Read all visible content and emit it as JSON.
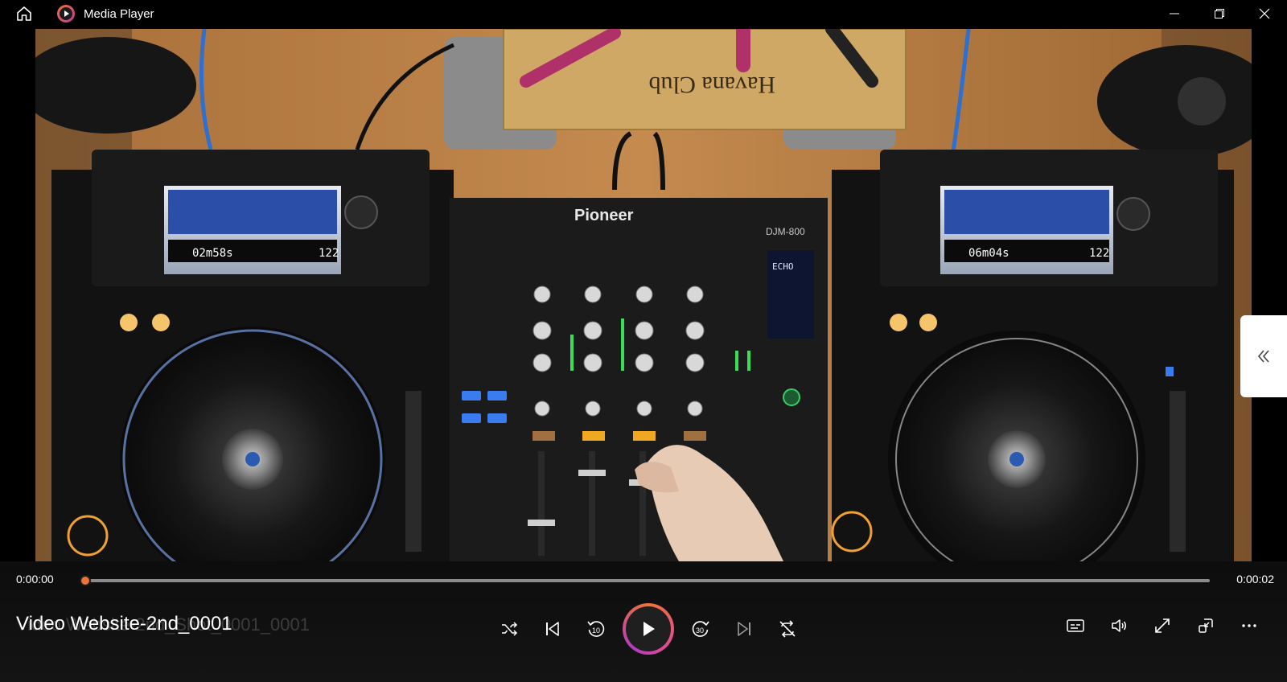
{
  "window": {
    "title": "Media Player",
    "minimize_label": "Minimize",
    "maximize_label": "Maximize",
    "close_label": "Close"
  },
  "player": {
    "current_time": "0:00:00",
    "total_time": "0:00:02",
    "progress": 0.0,
    "media_title": "Video Website-2nd_0001",
    "ghost_title": "Video Website-2nd_Shot_0001_0001"
  },
  "colors": {
    "accent": "#f07236",
    "titlebar_bg": "#000000",
    "controls_bg": "#121212"
  },
  "icons": {
    "home": "home-icon",
    "app": "media-player-app-icon",
    "shuffle": "shuffle-icon",
    "previous": "previous-icon",
    "rewind": "rewind-10-icon",
    "play": "play-icon",
    "forward": "forward-30-icon",
    "next": "next-icon",
    "repeat": "repeat-off-icon",
    "captions": "captions-icon",
    "volume": "volume-icon",
    "fullscreen": "fullscreen-icon",
    "miniplayer": "miniplayer-icon",
    "more": "more-icon",
    "side_toggle": "chevron-double-left-icon"
  },
  "video_scene": {
    "mixer_brand": "Pioneer",
    "mixer_model": "DJM-800",
    "bottle_label": "Havana Club",
    "left_screen_track": "02m58s",
    "left_screen_bpm": "122",
    "right_screen_track": "06m04s",
    "right_screen_bpm": "122",
    "fx_display": "ECHO"
  }
}
